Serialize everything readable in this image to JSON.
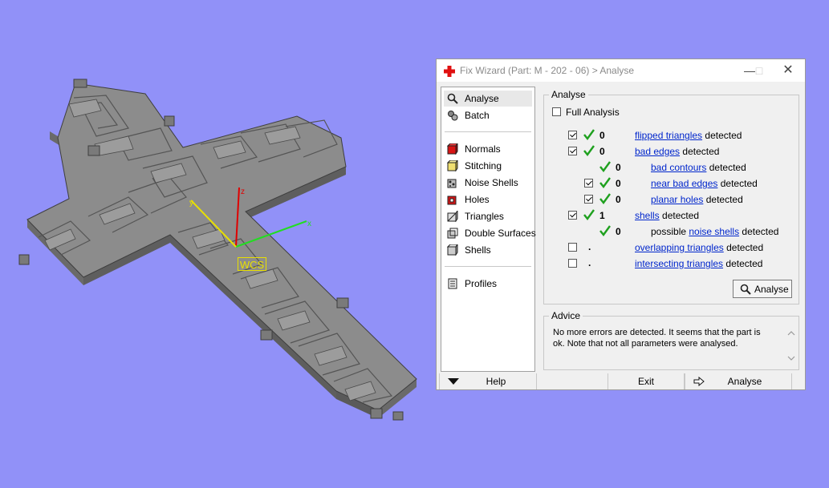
{
  "viewport": {
    "wcs_label": "WCS",
    "axes": {
      "x": "x",
      "y": "y",
      "z": "z"
    }
  },
  "dialog": {
    "title": "Fix Wizard (Part: M - 202 - 06) > Analyse",
    "nav": {
      "items": [
        {
          "label": "Analyse",
          "icon": "magnifier-icon",
          "active": true
        },
        {
          "label": "Batch",
          "icon": "gears-icon"
        },
        {
          "label": "Normals",
          "icon": "cube-red-icon"
        },
        {
          "label": "Stitching",
          "icon": "cube-yellow-icon"
        },
        {
          "label": "Noise Shells",
          "icon": "noise-shells-icon"
        },
        {
          "label": "Holes",
          "icon": "cube-red-holes-icon"
        },
        {
          "label": "Triangles",
          "icon": "triangles-icon"
        },
        {
          "label": "Double Surfaces",
          "icon": "double-surfaces-icon"
        },
        {
          "label": "Shells",
          "icon": "shells-icon"
        },
        {
          "label": "Profiles",
          "icon": "profiles-icon"
        }
      ]
    },
    "analyse": {
      "legend": "Analyse",
      "full_analysis_label": "Full Analysis",
      "full_analysis_checked": false,
      "rows": [
        {
          "checked": true,
          "status": "ok",
          "count": "0",
          "link": "flipped triangles",
          "suffix": "detected"
        },
        {
          "checked": true,
          "status": "ok",
          "count": "0",
          "link": "bad edges",
          "suffix": "detected"
        },
        {
          "checked": null,
          "status": "ok",
          "count": "0",
          "link": "bad contours",
          "suffix": "detected"
        },
        {
          "checked": true,
          "status": "ok",
          "count": "0",
          "link": "near bad edges",
          "suffix": "detected"
        },
        {
          "checked": true,
          "status": "ok",
          "count": "0",
          "link": "planar holes",
          "suffix": "detected"
        },
        {
          "checked": true,
          "status": "ok",
          "count": "1",
          "link": "shells",
          "suffix": "detected"
        },
        {
          "checked": null,
          "status": "ok",
          "count": "0",
          "prefix": "possible",
          "link": "noise shells",
          "suffix": "detected"
        },
        {
          "checked": false,
          "status": "none",
          "count": ".",
          "link": "overlapping triangles",
          "suffix": "detected"
        },
        {
          "checked": false,
          "status": "none",
          "count": ".",
          "link": "intersecting triangles",
          "suffix": "detected"
        }
      ],
      "button_label": "Analyse"
    },
    "advice": {
      "legend": "Advice",
      "text": "No more errors are detected. It seems that the part is ok. Note that not all parameters were analysed."
    },
    "bottom": {
      "help_label": "Help",
      "exit_label": "Exit",
      "analyse_label": "Analyse"
    },
    "colors": {
      "link": "#0026cc",
      "tick": "#1ea01e",
      "background": "#9191f8"
    }
  }
}
